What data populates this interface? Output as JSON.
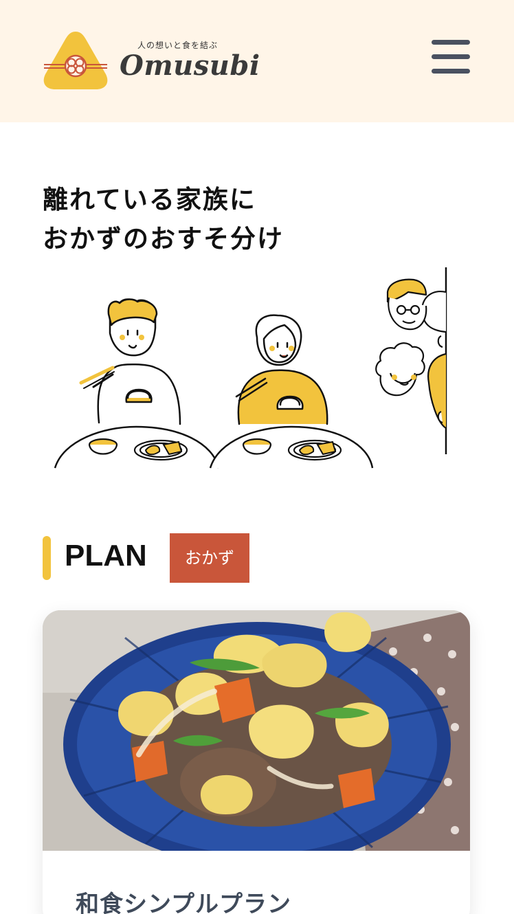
{
  "header": {
    "logo_tagline": "人の想いと食を結ぶ",
    "logo_word": "Omusubi",
    "menu_icon": "hamburger-menu-icon"
  },
  "hero": {
    "title_line1": "離れている家族に",
    "title_line2": "おかずのおすそ分け"
  },
  "plan": {
    "label": "PLAN",
    "tag": "おかず"
  },
  "card": {
    "title": "和食シンプルプラン"
  },
  "colors": {
    "header_bg": "#fff5e8",
    "accent_yellow": "#f2c33d",
    "tag_red": "#c9563a",
    "menu_gray": "#4a5160",
    "title_slate": "#3f4a5a"
  }
}
